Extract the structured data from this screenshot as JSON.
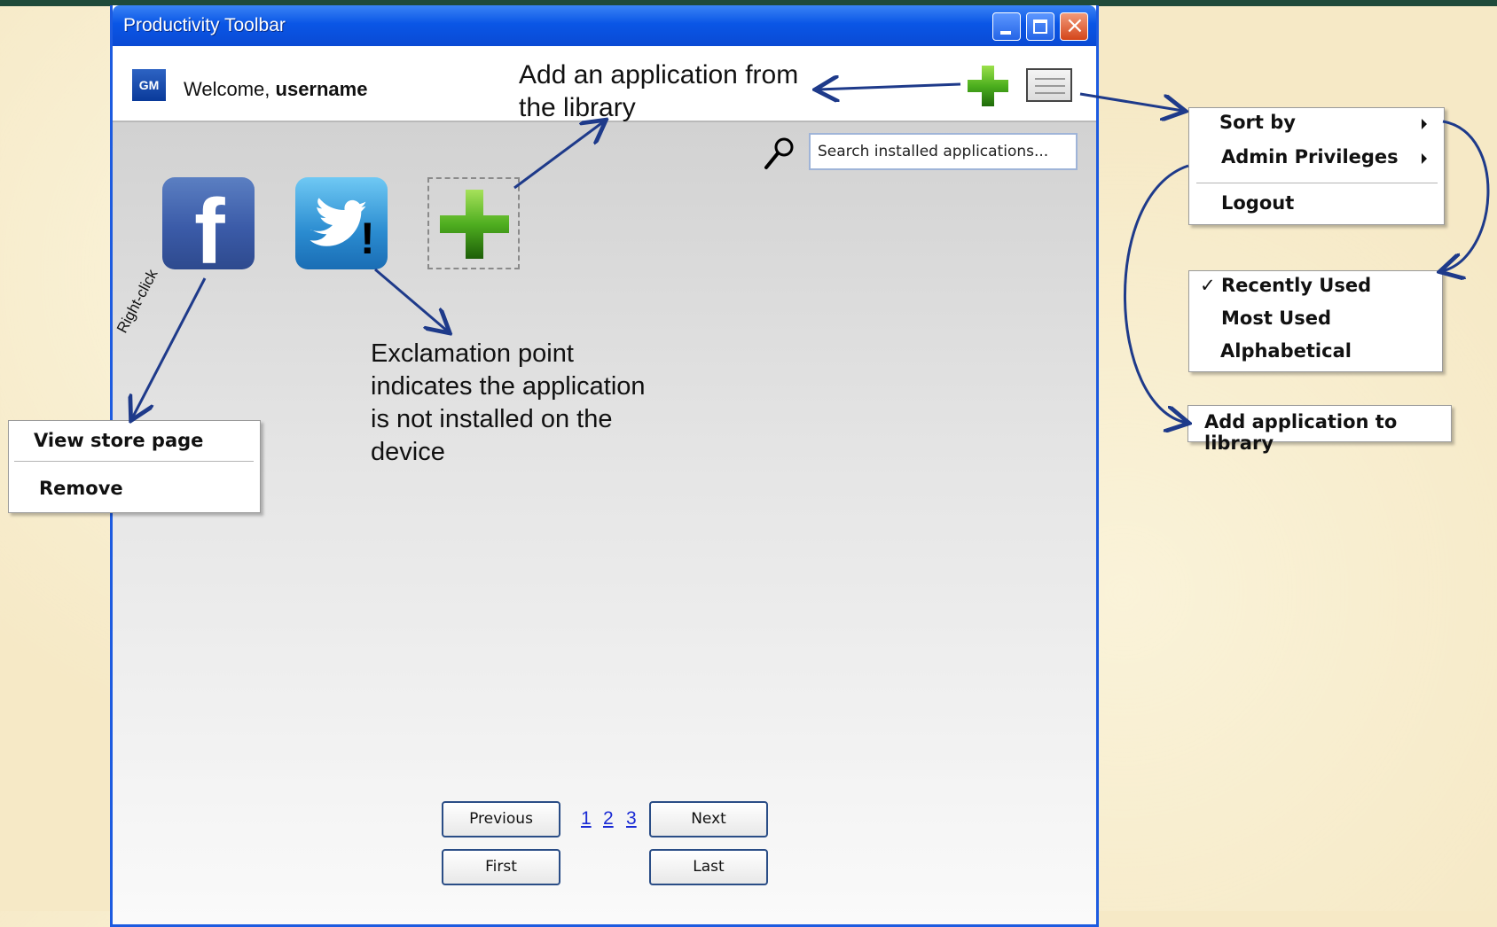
{
  "window": {
    "title": "Productivity Toolbar"
  },
  "header": {
    "welcome_prefix": "Welcome, ",
    "username": "username",
    "logo_text": "GM"
  },
  "search": {
    "placeholder": "Search installed applications..."
  },
  "apps": [
    {
      "name": "facebook",
      "glyph": "f"
    },
    {
      "name": "twitter",
      "badge": "!"
    }
  ],
  "pagination": {
    "previous": "Previous",
    "next": "Next",
    "first": "First",
    "last": "Last",
    "pages": [
      "1",
      "2",
      "3"
    ]
  },
  "annotations": {
    "add_app_line1": "Add an application from",
    "add_app_line2": "the library",
    "exclaim_line1": "Exclamation point",
    "exclaim_line2": "indicates the application",
    "exclaim_line3": "is not installed on the",
    "exclaim_line4": "device",
    "right_click": "Right-click"
  },
  "context_menu": {
    "view_store": "View store page",
    "remove": "Remove"
  },
  "main_menu": {
    "sort_by": "Sort by",
    "admin": "Admin Privileges",
    "logout": "Logout"
  },
  "sort_menu": {
    "check": "✓",
    "recently_used": "Recently Used",
    "most_used": "Most Used",
    "alphabetical": "Alphabetical"
  },
  "admin_menu": {
    "add_to_library": "Add application to library"
  },
  "colors": {
    "titlebar": "#0a56e6",
    "background": "#f6e9c6",
    "arrow": "#1e3a8a"
  }
}
